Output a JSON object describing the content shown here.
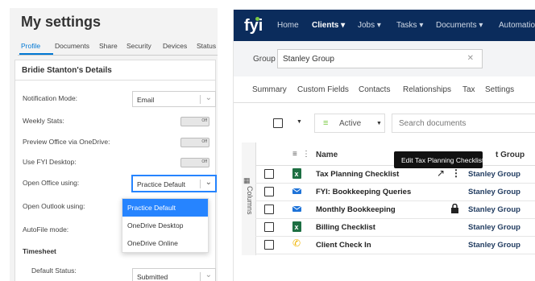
{
  "settings": {
    "title": "My settings",
    "tabs": [
      "Profile",
      "Documents",
      "Share",
      "Security",
      "Devices",
      "Status"
    ],
    "details_title": "Bridie Stanton's Details",
    "fields": {
      "notification_mode": {
        "label": "Notification Mode:",
        "value": "Email"
      },
      "weekly_stats": {
        "label": "Weekly Stats:",
        "toggle": "Off"
      },
      "preview_office": {
        "label": "Preview Office via OneDrive:",
        "toggle": "Off"
      },
      "use_fyi_desktop": {
        "label": "Use FYI Desktop:",
        "toggle": "Off"
      },
      "open_office": {
        "label": "Open Office using:",
        "value": "Practice Default"
      },
      "open_outlook": {
        "label": "Open Outlook using:"
      },
      "autofile": {
        "label": "AutoFile mode:"
      },
      "timesheet": {
        "label": "Timesheet"
      },
      "default_status": {
        "label": "Default Status:",
        "value": "Submitted"
      }
    },
    "dropdown_options": [
      "Practice Default",
      "OneDrive Desktop",
      "OneDrive Online"
    ]
  },
  "app": {
    "logo": "fyi",
    "nav": [
      "Home",
      "Clients",
      "Jobs",
      "Tasks",
      "Documents",
      "Automatio"
    ],
    "group_label": "Group",
    "group_value": "Stanley Group",
    "subtabs": [
      "Summary",
      "Custom Fields",
      "Contacts",
      "Relationships",
      "Tax",
      "Settings"
    ],
    "filter_value": "Active",
    "search_placeholder": "Search documents",
    "columns_label": "Columns",
    "headers": {
      "name": "Name",
      "client": "t Group"
    },
    "tooltip": "Edit Tax Planning Checklist",
    "rows": [
      {
        "name": "Tax Planning Checklist",
        "client": "Stanley Group",
        "icon": "excel-icon"
      },
      {
        "name": "FYI: Bookkeeping Queries",
        "client": "Stanley Group",
        "icon": "email-icon"
      },
      {
        "name": "Monthly Bookkeeping",
        "client": "Stanley Group",
        "icon": "email-icon"
      },
      {
        "name": "Billing Checklist",
        "client": "Stanley Group",
        "icon": "excel-icon"
      },
      {
        "name": "Client Check In",
        "client": "Stanley Group",
        "icon": "phone-icon"
      }
    ]
  }
}
